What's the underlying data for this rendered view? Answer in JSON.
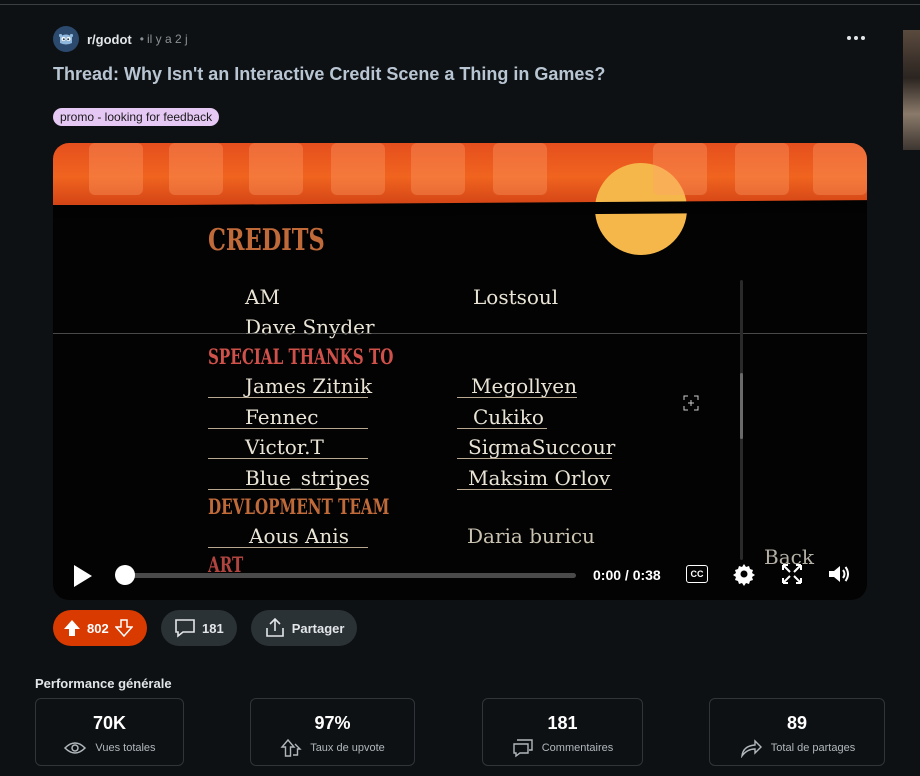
{
  "post": {
    "subreddit": "r/godot",
    "separator": "•",
    "age": "il y a 2 j",
    "title": "Thread: Why Isn't an Interactive Credit Scene a Thing in Games?",
    "flair": "promo - looking for feedback"
  },
  "video": {
    "credits_title": "CREDITS",
    "names_top": [
      "AM",
      "Lostsoul",
      "Dave Snyder"
    ],
    "special_thanks_heading": "SPECIAL THANKS TO",
    "special_thanks": [
      [
        "James Zitnik",
        "Megollyen"
      ],
      [
        "Fennec",
        "Cukiko"
      ],
      [
        "Victor.T",
        "SigmaSuccour"
      ],
      [
        "Blue_stripes",
        "Maksim Orlov"
      ]
    ],
    "dev_team_heading": "DEVLOPMENT TEAM",
    "dev_team": [
      "Aous Anis",
      "Daria buricu"
    ],
    "art_heading": "ART",
    "back_label": "Back",
    "time": "0:00 / 0:38",
    "progress_fraction": 0,
    "cc_label": "CC",
    "colors": {
      "banner": "#f0641f",
      "sun": "#f6b74a",
      "heading_orange": "#c06a3a",
      "heading_red": "#d0504a"
    }
  },
  "actions": {
    "upvotes": "802",
    "comments": "181",
    "share_label": "Partager",
    "vote_color": "#d93a00"
  },
  "performance": {
    "title": "Performance générale",
    "stats": [
      {
        "value": "70K",
        "label": "Vues totales",
        "icon": "views-icon"
      },
      {
        "value": "97%",
        "label": "Taux de upvote",
        "icon": "upvote-rate-icon"
      },
      {
        "value": "181",
        "label": "Commentaires",
        "icon": "comments-icon"
      },
      {
        "value": "89",
        "label": "Total de partages",
        "icon": "share-arrow-icon"
      }
    ]
  }
}
